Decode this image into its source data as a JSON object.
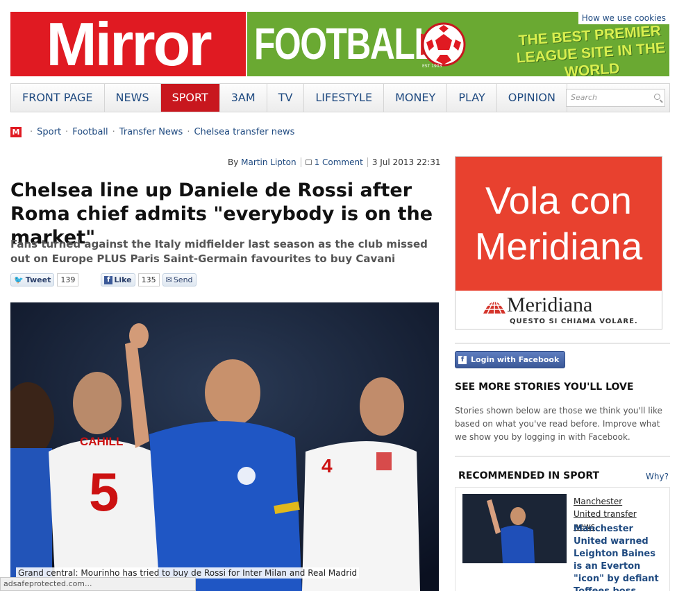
{
  "header": {
    "logo": "Mirror",
    "section_banner": "FOOTBALL",
    "established": "EST 1903",
    "tagline": "THE BEST PREMIER LEAGUE SITE IN THE WORLD",
    "cookies_link": "How we use cookies"
  },
  "nav": {
    "items": [
      "FRONT PAGE",
      "NEWS",
      "SPORT",
      "3AM",
      "TV",
      "LIFESTYLE",
      "MONEY",
      "PLAY",
      "OPINION"
    ],
    "active": "SPORT",
    "search_placeholder": "Search"
  },
  "breadcrumb": {
    "logo": "M",
    "items": [
      "Sport",
      "Football",
      "Transfer News",
      "Chelsea transfer news"
    ]
  },
  "article": {
    "byline_prefix": "By",
    "author": "Martin Lipton",
    "comments": "1 Comment",
    "date": "3 Jul 2013 22:31",
    "headline": "Chelsea line up Daniele de Rossi after Roma chief admits \"everybody is on the market\"",
    "standfirst": "Fans turned against the Italy midfielder last season as the club missed out on Europe PLUS Paris Saint-Germain favourites to buy Cavani",
    "caption": "Grand central: Mourinho has tried to buy de Rossi for Inter Milan and Real Madrid",
    "photo_shirt_name": "CAHILL",
    "photo_shirt_number_1": "5",
    "photo_shirt_number_2": "4"
  },
  "social": {
    "tweet_label": "Tweet",
    "tweet_count": "139",
    "like_label": "Like",
    "like_count": "135",
    "send_label": "Send"
  },
  "ad": {
    "line1": "Vola con",
    "line2": "Meridiana",
    "brand": "Meridiana",
    "tagline": "QUESTO SI CHIAMA VOLARE."
  },
  "sidebar": {
    "fb_login": "Login with Facebook",
    "see_more_title": "SEE MORE STORIES YOU'LL LOVE",
    "stories_text": "Stories shown below are those we think you'll like based on what you've read before. Improve what we show you by logging in with Facebook.",
    "rec_title": "RECOMMENDED IN SPORT",
    "why": "Why?",
    "rec_category": "Manchester United transfer news",
    "rec_headline": "Manchester United warned Leighton Baines is an Everton \"icon\" by defiant Toffees boss Martinez"
  },
  "statusbar": {
    "text": "adsafeprotected.com..."
  },
  "colors": {
    "mirror_red": "#e01a22",
    "sport_red": "#c8171e",
    "football_green": "#6aa932",
    "link_blue": "#1f4a80"
  }
}
